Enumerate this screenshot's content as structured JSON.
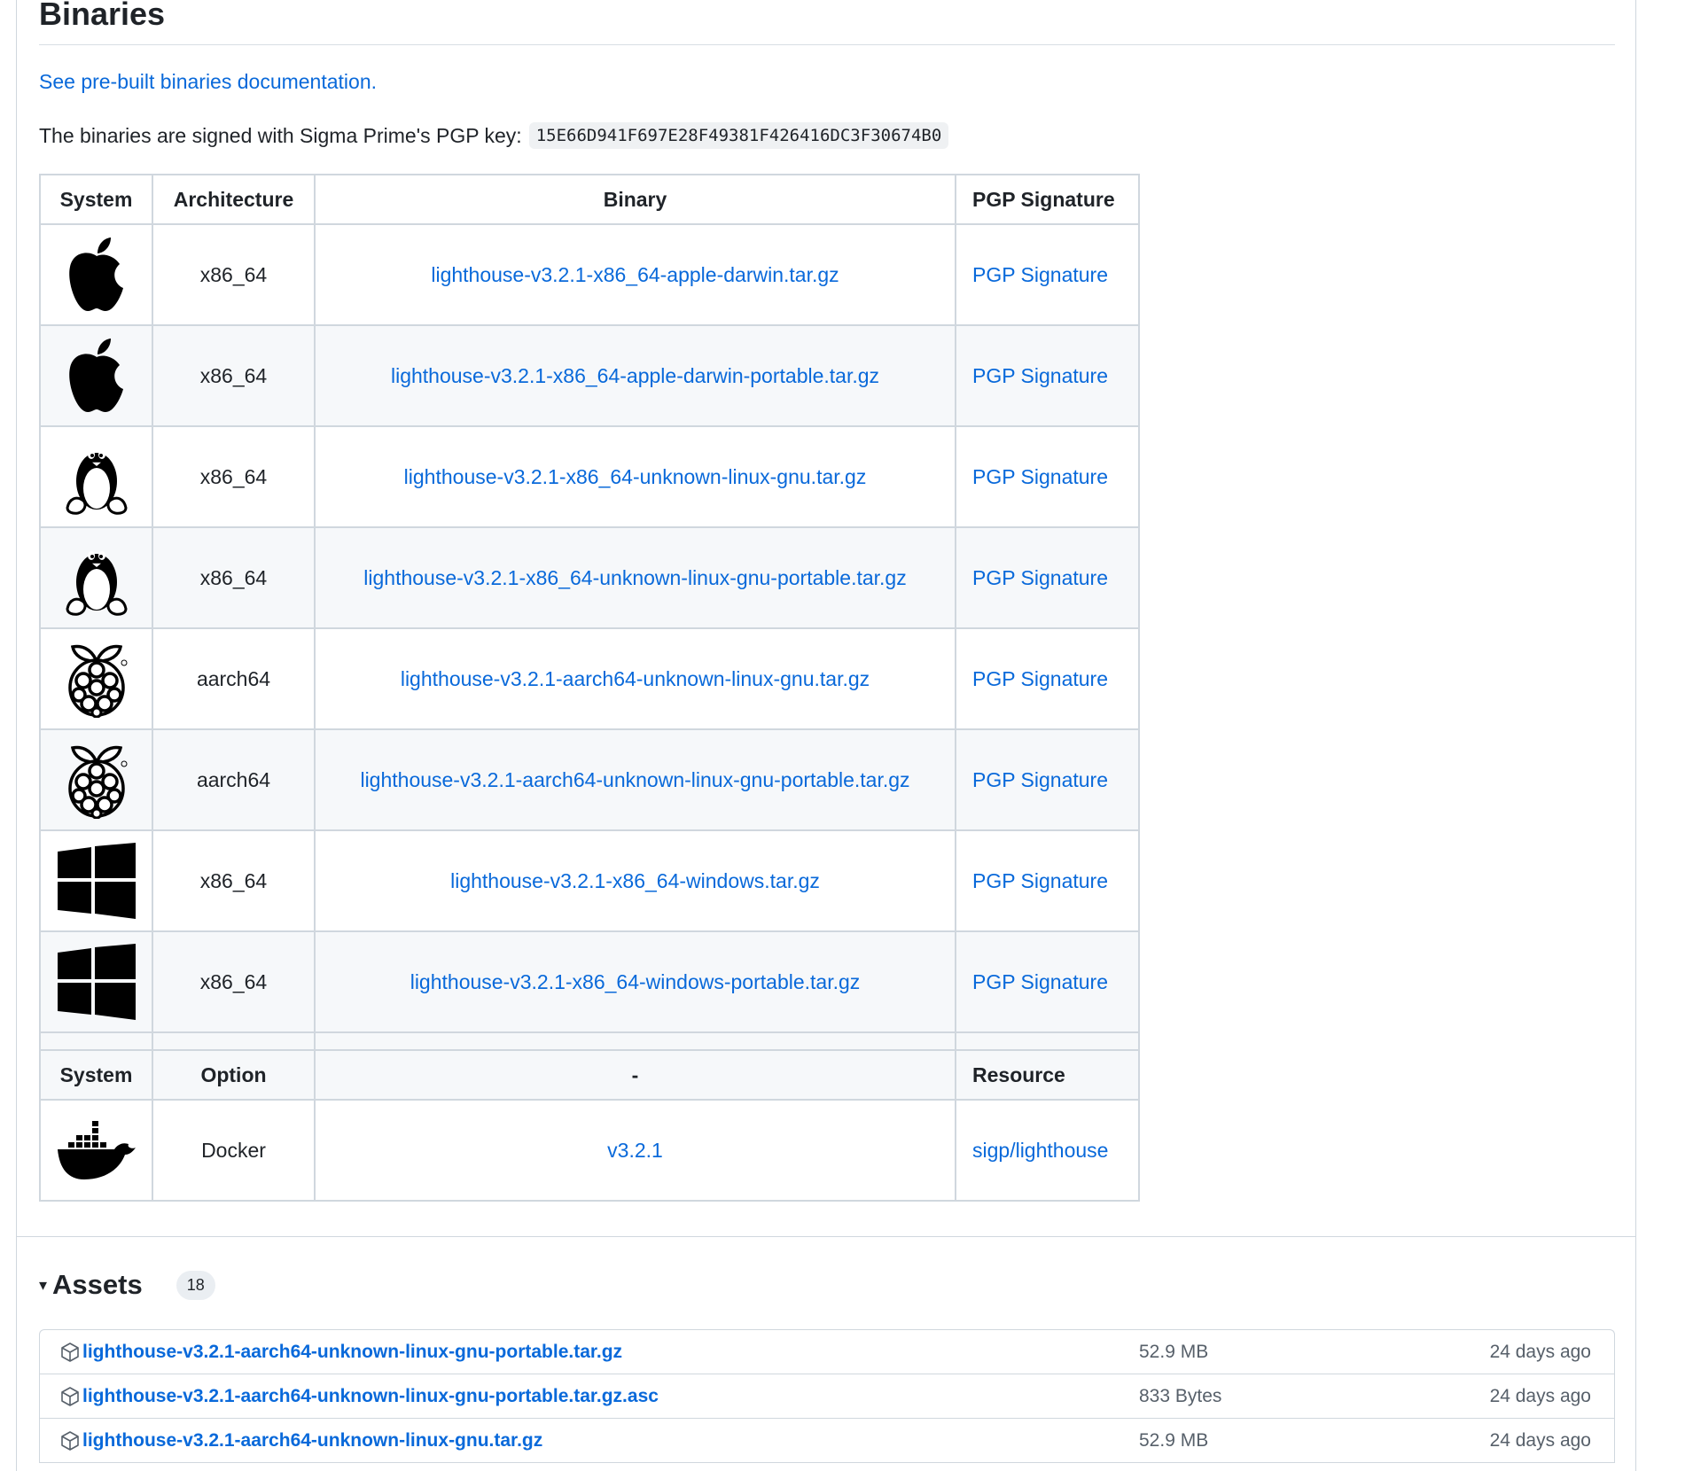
{
  "heading": "Binaries",
  "doc_link": "See pre-built binaries documentation.",
  "pgp_text": "The binaries are signed with Sigma Prime's PGP key:",
  "pgp_key": "15E66D941F697E28F49381F426416DC3F30674B0",
  "table": {
    "headers": [
      "System",
      "Architecture",
      "Binary",
      "PGP Signature"
    ],
    "rows": [
      {
        "system_icon": "apple-icon",
        "arch": "x86_64",
        "binary": "lighthouse-v3.2.1-x86_64-apple-darwin.tar.gz",
        "sig": "PGP Signature"
      },
      {
        "system_icon": "apple-icon",
        "arch": "x86_64",
        "binary": "lighthouse-v3.2.1-x86_64-apple-darwin-portable.tar.gz",
        "sig": "PGP Signature"
      },
      {
        "system_icon": "linux-tux-icon",
        "arch": "x86_64",
        "binary": "lighthouse-v3.2.1-x86_64-unknown-linux-gnu.tar.gz",
        "sig": "PGP Signature"
      },
      {
        "system_icon": "linux-tux-icon",
        "arch": "x86_64",
        "binary": "lighthouse-v3.2.1-x86_64-unknown-linux-gnu-portable.tar.gz",
        "sig": "PGP Signature"
      },
      {
        "system_icon": "raspberry-pi-icon",
        "arch": "aarch64",
        "binary": "lighthouse-v3.2.1-aarch64-unknown-linux-gnu.tar.gz",
        "sig": "PGP Signature"
      },
      {
        "system_icon": "raspberry-pi-icon",
        "arch": "aarch64",
        "binary": "lighthouse-v3.2.1-aarch64-unknown-linux-gnu-portable.tar.gz",
        "sig": "PGP Signature"
      },
      {
        "system_icon": "windows-icon",
        "arch": "x86_64",
        "binary": "lighthouse-v3.2.1-x86_64-windows.tar.gz",
        "sig": "PGP Signature"
      },
      {
        "system_icon": "windows-icon",
        "arch": "x86_64",
        "binary": "lighthouse-v3.2.1-x86_64-windows-portable.tar.gz",
        "sig": "PGP Signature"
      }
    ],
    "headers2": [
      "System",
      "Option",
      "-",
      "Resource"
    ],
    "docker_row": {
      "system_icon": "docker-icon",
      "option": "Docker",
      "version": "v3.2.1",
      "resource": "sigp/lighthouse"
    }
  },
  "assets": {
    "title": "Assets",
    "count": "18",
    "items": [
      {
        "name": "lighthouse-v3.2.1-aarch64-unknown-linux-gnu-portable.tar.gz",
        "size": "52.9 MB",
        "date": "24 days ago"
      },
      {
        "name": "lighthouse-v3.2.1-aarch64-unknown-linux-gnu-portable.tar.gz.asc",
        "size": "833 Bytes",
        "date": "24 days ago"
      },
      {
        "name": "lighthouse-v3.2.1-aarch64-unknown-linux-gnu.tar.gz",
        "size": "52.9 MB",
        "date": "24 days ago"
      }
    ]
  }
}
